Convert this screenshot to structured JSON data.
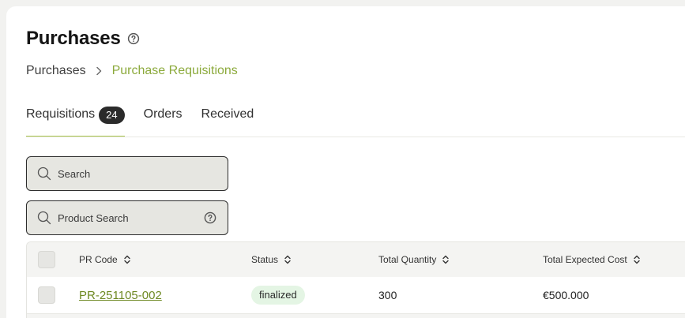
{
  "page": {
    "title": "Purchases",
    "breadcrumb": {
      "root": "Purchases",
      "current": "Purchase Requisitions"
    }
  },
  "tabs": [
    {
      "label": "Requisitions",
      "count": "24",
      "active": true
    },
    {
      "label": "Orders"
    },
    {
      "label": "Received"
    }
  ],
  "filters": {
    "search_placeholder": "Search",
    "product_search_placeholder": "Product Search"
  },
  "table": {
    "columns": [
      "PR Code",
      "Status",
      "Total Quantity",
      "Total Expected Cost"
    ],
    "rows": [
      {
        "pr_code": "PR-251105-002",
        "status": "finalized",
        "total_quantity": "300",
        "total_expected_cost": "€500.000"
      }
    ]
  },
  "colors": {
    "accent": "#a8c44a",
    "link": "#6f8a24",
    "status_finalized_bg": "#e4f5e4"
  },
  "icons": [
    "help-circle-icon",
    "chevron-right-icon",
    "search-icon",
    "sort-icon"
  ]
}
